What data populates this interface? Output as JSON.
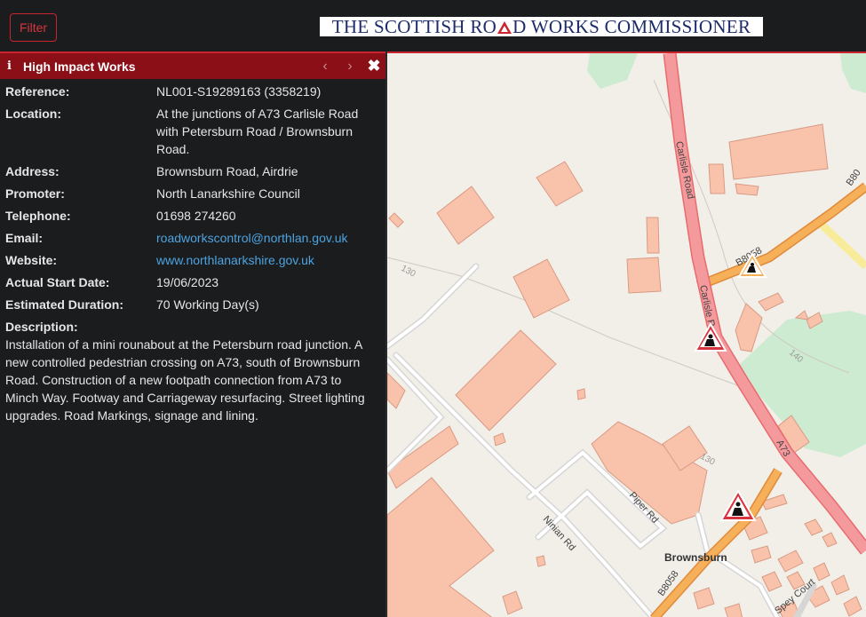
{
  "topbar": {
    "filter_label": "Filter",
    "logo_part1": "THE SCOTTISH RO",
    "logo_part2": "D WORKS COMMISSIONER"
  },
  "panel": {
    "title": "High Impact Works",
    "info_icon": "info-icon",
    "prev_icon": "‹",
    "next_icon": "›",
    "close_icon": "✖",
    "fields": {
      "reference_label": "Reference:",
      "reference_value": "NL001-S19289163 (3358219)",
      "location_label": "Location:",
      "location_value": "At the junctions of A73 Carlisle Road with Petersburn Road / Brownsburn Road.",
      "address_label": "Address:",
      "address_value": "Brownsburn Road, Airdrie",
      "promoter_label": "Promoter:",
      "promoter_value": "North Lanarkshire Council",
      "telephone_label": "Telephone:",
      "telephone_value": "01698 274260",
      "email_label": "Email:",
      "email_value": "roadworkscontrol@northlan.gov.uk",
      "website_label": "Website:",
      "website_value": "www.northlanarkshire.gov.uk",
      "start_label": "Actual Start Date:",
      "start_value": "19/06/2023",
      "duration_label": "Estimated Duration:",
      "duration_value": "70 Working Day(s)",
      "description_label": "Description:",
      "description_value": "Installation of a mini rounabout at the Petersburn road junction. A new controlled pedestrian crossing on A73, south of Brownsburn Road. Construction of a new footpath connection from A73 to Minch Way. Footway and Carriageway resurfacing. Street lighting upgrades. Road Markings, signage and lining."
    }
  },
  "map": {
    "labels": {
      "carlisle_road_1": "Carlisle Road",
      "carlisle_road_2": "Carlisle R",
      "a73": "A73",
      "b8058_top": "B80",
      "b8058_mid": "B8058",
      "b8058_bottom": "B8058",
      "ninian_rd": "Ninian Rd",
      "piper_rd": "Piper Rd",
      "spey_court": "Spey Court",
      "brownsburn": "Brownsburn",
      "contour_130a": "130",
      "contour_130b": "130",
      "contour_140": "140"
    },
    "colors": {
      "building": "#f9c3ab",
      "building_stroke": "#d99a84",
      "park": "#cdebd0",
      "a_road": "#f08e91",
      "b_road": "#f3a04d",
      "minor_road": "#d9d9d9"
    },
    "roadworks_icon": "roadworks-warning-icon"
  }
}
